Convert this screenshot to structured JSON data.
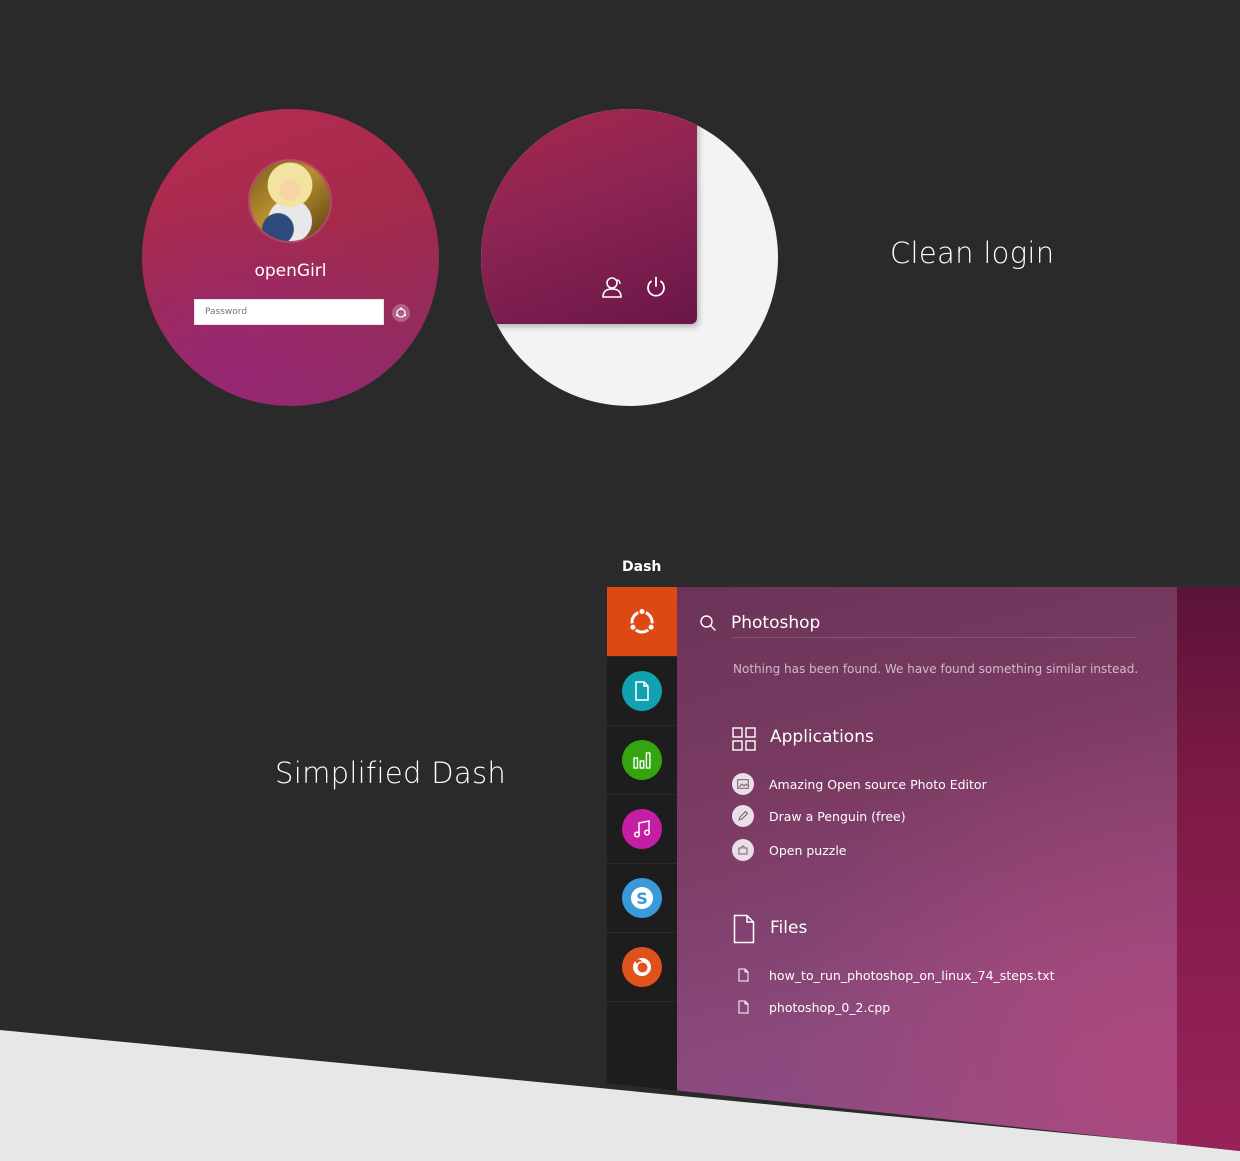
{
  "login": {
    "username": "openGirl",
    "password_placeholder": "Password"
  },
  "labels": {
    "clean_login": "Clean login",
    "simplified_dash": "Simplified Dash"
  },
  "dash": {
    "window_title": "Dash",
    "search_query": "Photoshop",
    "no_results_note": "Nothing has been found. We have found something similar instead.",
    "launcher": [
      {
        "name": "ubuntu-icon",
        "color": "#dd4814"
      },
      {
        "name": "document-icon",
        "color": "#12a1b0"
      },
      {
        "name": "chart-icon",
        "color": "#34a50f"
      },
      {
        "name": "music-icon",
        "color": "#c41fa4"
      },
      {
        "name": "skype-icon",
        "color": "#3a9ad9"
      },
      {
        "name": "firefox-icon",
        "color": "#e0521c"
      }
    ],
    "applications": {
      "title": "Applications",
      "items": [
        {
          "label": "Amazing Open source Photo Editor",
          "icon": "image-icon"
        },
        {
          "label": "Draw a Penguin (free)",
          "icon": "pencil-icon"
        },
        {
          "label": "Open puzzle",
          "icon": "puzzle-icon"
        }
      ]
    },
    "files": {
      "title": "Files",
      "items": [
        {
          "label": "how_to_run_photoshop_on_linux_74_steps.txt",
          "icon": "file-icon"
        },
        {
          "label": "photoshop_0_2.cpp",
          "icon": "file-icon"
        }
      ]
    }
  }
}
